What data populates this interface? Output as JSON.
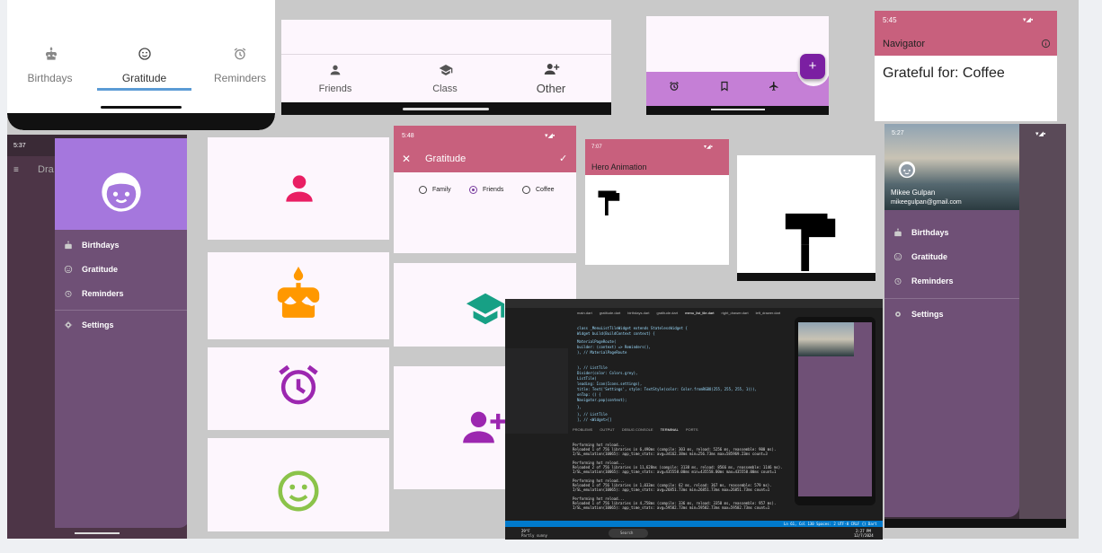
{
  "colors": {
    "pink": "#c8607d",
    "purple": "#a577dd",
    "drawer_bg": "#6a4a74",
    "accent_pink": "#e91e63",
    "accent_orange": "#ff9800",
    "accent_purple": "#9c27b0",
    "accent_green": "#8bc34a",
    "accent_teal": "#17a085"
  },
  "nav1": {
    "items": [
      {
        "label": "Birthdays",
        "icon": "cake-icon"
      },
      {
        "label": "Gratitude",
        "icon": "smiley-icon"
      },
      {
        "label": "Reminders",
        "icon": "alarm-icon"
      }
    ]
  },
  "nav2": {
    "items": [
      {
        "label": "Friends",
        "icon": "person-icon"
      },
      {
        "label": "Class",
        "icon": "school-icon"
      },
      {
        "label": "Other",
        "icon": "group-add-icon"
      }
    ]
  },
  "nav3": {
    "fab": "+",
    "items": [
      "alarm-icon",
      "bookmark-icon",
      "flight-icon"
    ]
  },
  "navigator": {
    "time": "5:45",
    "title": "Navigator",
    "body": "Grateful for: Coffee"
  },
  "drawer1": {
    "time": "5:37",
    "title": "Dra",
    "items": [
      {
        "label": "Birthdays",
        "icon": "cake-icon"
      },
      {
        "label": "Gratitude",
        "icon": "smiley-icon"
      },
      {
        "label": "Reminders",
        "icon": "alarm-icon"
      },
      {
        "label": "Settings",
        "icon": "gear-icon"
      }
    ]
  },
  "gratitude": {
    "time": "5:48",
    "title": "Gratitude",
    "options": [
      "Family",
      "Friends",
      "Coffee"
    ],
    "selected": "Friends"
  },
  "hero": {
    "time": "7:07",
    "title": "Hero Animation"
  },
  "drawer2": {
    "time": "5:27",
    "name": "Mikee Gulpan",
    "email": "mikeegulpan@gmail.com",
    "items": [
      {
        "label": "Birthdays",
        "icon": "cake-icon"
      },
      {
        "label": "Gratitude",
        "icon": "smiley-icon"
      },
      {
        "label": "Reminders",
        "icon": "alarm-icon"
      },
      {
        "label": "Settings",
        "icon": "gear-icon"
      }
    ]
  },
  "ide": {
    "tabs": [
      "main.dart",
      "gratitude.dart",
      "birthdays.dart",
      "gratitude.dart",
      "menu_list_tile.dart",
      "right_drawer.dart",
      "left_drawer.dart"
    ],
    "code": [
      "class _MenuListTileWidget extends StatelessWidget {",
      "  Widget build(BuildContext context) {",
      "    MaterialPageRoute(",
      "      builder: (context) => Reminders(),",
      "    ), // MaterialPageRoute",
      "  ), // ListTile",
      "  Divider(color: Colors.grey),",
      "  ListTile(",
      "    leading: Icon(Icons.settings),",
      "    title: Text('Settings', style: TextStyle(color: Color.fromRGBO(255, 255, 255, 1))),",
      "    onTap: () {",
      "      Navigator.pop(context);",
      "    },",
      "  ), // ListTile",
      "], // <Widget>[]"
    ],
    "terminal_tabs": [
      "PROBLEMS",
      "OUTPUT",
      "DEBUG CONSOLE",
      "TERMINAL",
      "PORTS"
    ],
    "terminal": [
      "Performing hot reload...",
      "Reloaded 1 of 756 libraries in 6,490ms (compile: 303 ms, reload: 5256 ms, reassemble: 900 ms).",
      "I/SL_emulation(10065): app_time_stats: avg=34162.38ms min=256.73ms max=585969.23ms count=3",
      "Performing hot reload...",
      "Reloaded 2 of 756 libraries in 11,628ms (compile: 3138 ms, reload: 8566 ms, reassemble: 1146 ms).",
      "I/SL_emulation(10065): app_time_stats: avg=435558.00ms min=435558.00ms max=435558.00ms count=1",
      "Performing hot reload...",
      "Reloaded 1 of 756 libraries in 1,033ms (compile: 62 ms, reload: 367 ms, reassemble: 579 ms).",
      "I/SL_emulation(10065): app_time_stats: avg=26851.73ms min=26851.73ms max=26851.73ms count=1",
      "Performing hot reload...",
      "Reloaded 1 of 756 libraries in 4,758ms (compile: 336 ms, reload: 3358 ms, reassemble: 957 ms).",
      "I/SL_emulation(10065): app_time_stats: avg=59582.73ms min=59582.73ms max=59582.73ms count=1"
    ],
    "status": "Ln 61, Col 130  Spaces: 2  UTF-8  CRLF  {} Dart",
    "clock": "2:27 PM",
    "date": "12/7/2024",
    "weather": "29°F",
    "weather_desc": "Partly sunny",
    "search": "Search"
  }
}
